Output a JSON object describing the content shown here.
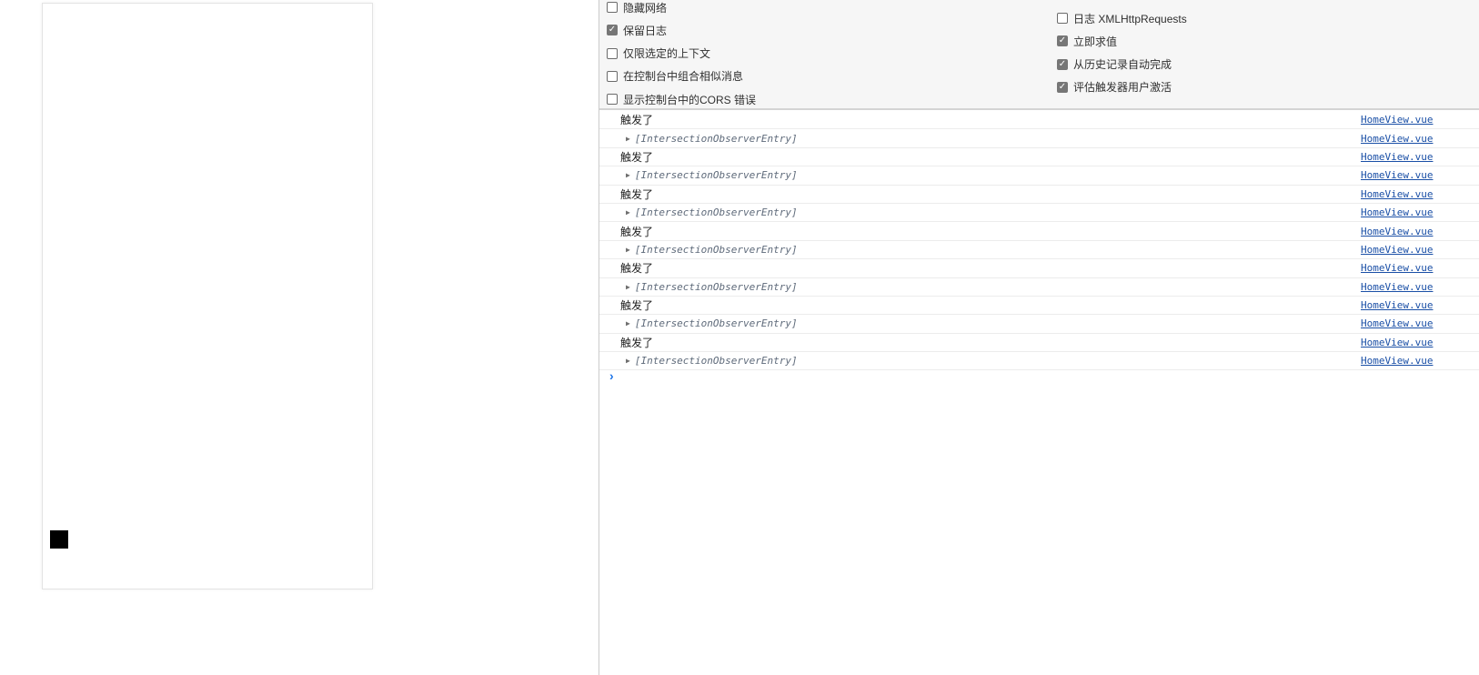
{
  "settings": {
    "left": [
      {
        "label": "隐藏网络",
        "checked": false
      },
      {
        "label": "保留日志",
        "checked": true
      },
      {
        "label": "仅限选定的上下文",
        "checked": false
      },
      {
        "label": "在控制台中组合相似消息",
        "checked": false
      },
      {
        "label": "显示控制台中的CORS 错误",
        "checked": false
      }
    ],
    "right": [
      {
        "label": "日志 XMLHttpRequests",
        "checked": false
      },
      {
        "label": "立即求值",
        "checked": true
      },
      {
        "label": "从历史记录自动完成",
        "checked": true
      },
      {
        "label": "评估触发器用户激活",
        "checked": true
      }
    ]
  },
  "console": {
    "entries": [
      {
        "message": "触发了",
        "object": "[IntersectionObserverEntry]",
        "source": "HomeView.vue"
      },
      {
        "message": "触发了",
        "object": "[IntersectionObserverEntry]",
        "source": "HomeView.vue"
      },
      {
        "message": "触发了",
        "object": "[IntersectionObserverEntry]",
        "source": "HomeView.vue"
      },
      {
        "message": "触发了",
        "object": "[IntersectionObserverEntry]",
        "source": "HomeView.vue"
      },
      {
        "message": "触发了",
        "object": "[IntersectionObserverEntry]",
        "source": "HomeView.vue"
      },
      {
        "message": "触发了",
        "object": "[IntersectionObserverEntry]",
        "source": "HomeView.vue"
      },
      {
        "message": "触发了",
        "object": "[IntersectionObserverEntry]",
        "source": "HomeView.vue"
      }
    ],
    "prompt": "›"
  }
}
